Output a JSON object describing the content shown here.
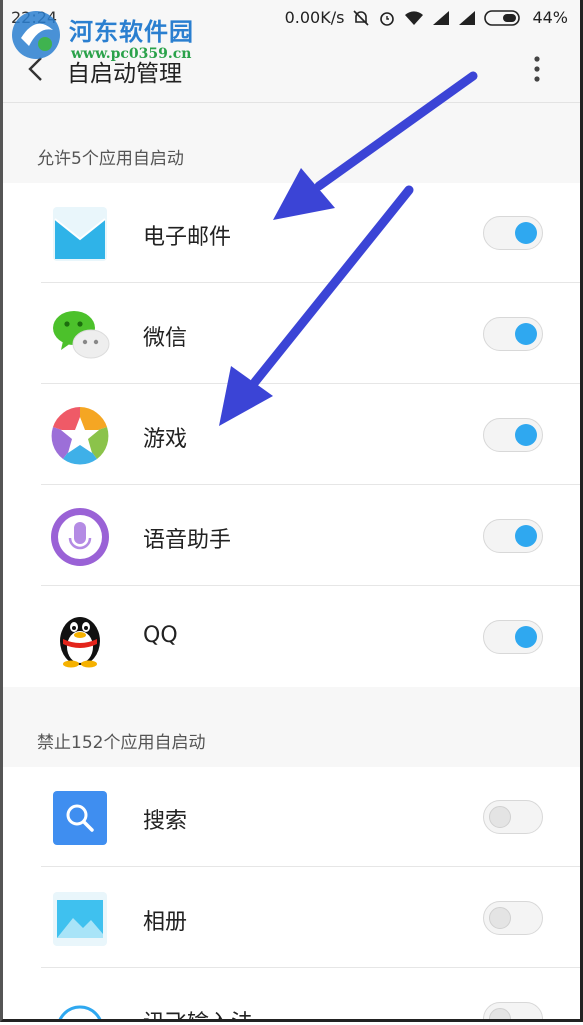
{
  "status": {
    "time": "22:24",
    "net_speed": "0.00K/s",
    "battery": "44%"
  },
  "watermark": {
    "title": "河东软件园",
    "url": "www.pc0359.cn"
  },
  "toolbar": {
    "title": "自启动管理"
  },
  "allowed": {
    "header": "允许5个应用自启动",
    "items": [
      {
        "label": "电子邮件",
        "enabled": true
      },
      {
        "label": "微信",
        "enabled": true
      },
      {
        "label": "游戏",
        "enabled": true
      },
      {
        "label": "语音助手",
        "enabled": true
      },
      {
        "label": "QQ",
        "enabled": true
      }
    ]
  },
  "blocked": {
    "header": "禁止152个应用自启动",
    "items": [
      {
        "label": "搜索",
        "enabled": false
      },
      {
        "label": "相册",
        "enabled": false
      },
      {
        "label": "讯飞输入法",
        "enabled": false
      }
    ]
  },
  "colors": {
    "accent": "#2fa8f0",
    "arrow": "#3b44d6",
    "background": "#f7f7f7"
  }
}
